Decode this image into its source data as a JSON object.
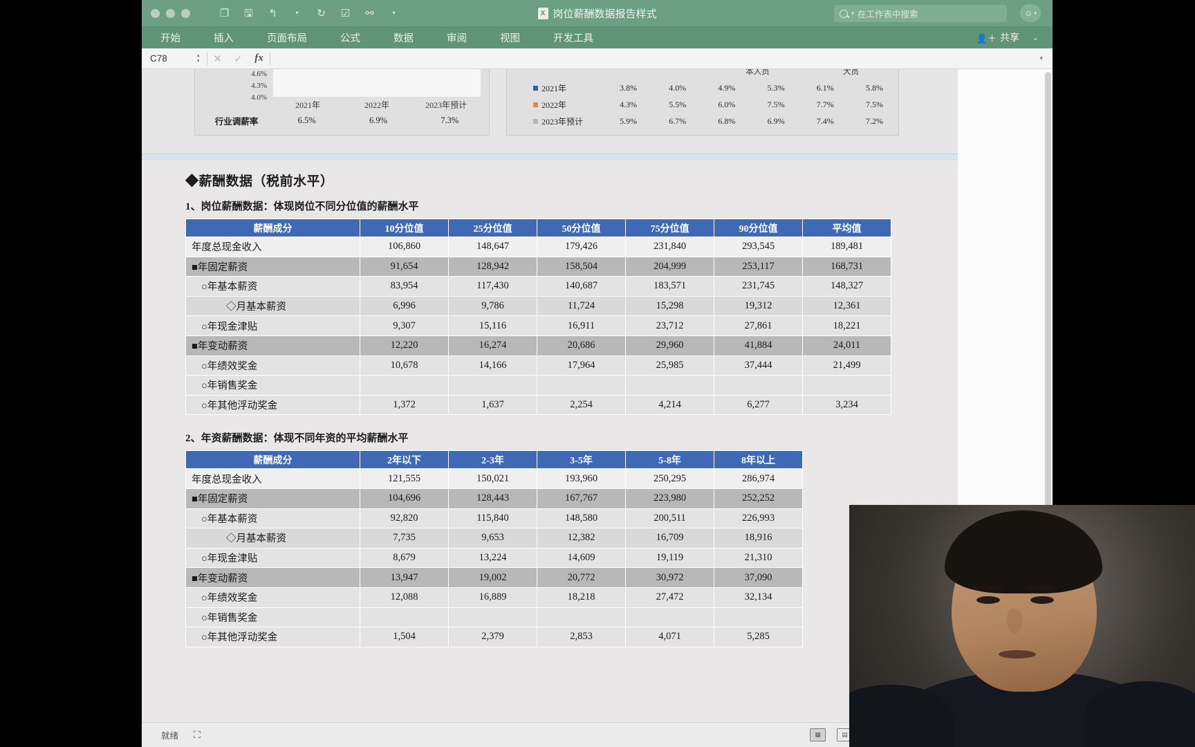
{
  "window": {
    "title": "岗位薪酬数据报告样式",
    "traffic_lights": [
      "close",
      "minimize",
      "zoom"
    ],
    "quick_access_icons": [
      "sidebar-icon",
      "save-icon",
      "undo-icon",
      "undo-caret-icon",
      "redo-icon",
      "edit-icon",
      "link-icon",
      "overflow-caret-icon"
    ],
    "search_placeholder": "在工作表中搜索",
    "share_label": "共享",
    "account_icon": "account-smiley-icon"
  },
  "ribbon": {
    "tabs": [
      "开始",
      "插入",
      "页面布局",
      "公式",
      "数据",
      "审阅",
      "视图",
      "开发工具"
    ],
    "active_tab": "开始"
  },
  "formula_bar": {
    "name_box": "C78",
    "cancel_icon": "cancel-icon",
    "confirm_icon": "confirm-icon",
    "fx_label": "fx",
    "value": ""
  },
  "charts": {
    "adjust_rate_chart": {
      "y_ticks": [
        "4.6%",
        "4.3%",
        "4.0%"
      ],
      "x_labels": [
        "2021年",
        "2022年",
        "2023年预计"
      ],
      "row_label": "行业调薪率",
      "row_values": [
        "6.5%",
        "6.9%",
        "7.3%"
      ]
    },
    "legend_chart": {
      "column_headers": [
        "本人员",
        "大员"
      ],
      "rows": [
        {
          "marker_color": "#2f5fa8",
          "label": "2021年",
          "values": [
            "3.8%",
            "4.0%",
            "4.9%",
            "5.3%",
            "6.1%",
            "5.8%"
          ]
        },
        {
          "marker_color": "#e08a3c",
          "label": "2022年",
          "values": [
            "4.3%",
            "5.5%",
            "6.0%",
            "7.5%",
            "7.7%",
            "7.5%"
          ]
        },
        {
          "marker_color": "#b4b4b4",
          "label": "2023年预计",
          "values": [
            "5.9%",
            "6.7%",
            "6.8%",
            "6.9%",
            "7.4%",
            "7.2%"
          ]
        }
      ]
    }
  },
  "content": {
    "section_title": "◆薪酬数据（税前水平）",
    "table1": {
      "caption": "1、岗位薪酬数据：体现岗位不同分位值的薪酬水平",
      "headers": [
        "薪酬成分",
        "10分位值",
        "25分位值",
        "50分位值",
        "75分位值",
        "90分位值",
        "平均值"
      ],
      "rows": [
        {
          "level": 0,
          "label": "年度总现金收入",
          "values": [
            "106,860",
            "148,647",
            "179,426",
            "231,840",
            "293,545",
            "189,481"
          ]
        },
        {
          "level": 1,
          "label": "■年固定薪资",
          "values": [
            "91,654",
            "128,942",
            "158,504",
            "204,999",
            "253,117",
            "168,731"
          ]
        },
        {
          "level": 2,
          "label": "○年基本薪资",
          "values": [
            "83,954",
            "117,430",
            "140,687",
            "183,571",
            "231,745",
            "148,327"
          ]
        },
        {
          "level": 3,
          "label": "◇月基本薪资",
          "values": [
            "6,996",
            "9,786",
            "11,724",
            "15,298",
            "19,312",
            "12,361"
          ]
        },
        {
          "level": 2,
          "label": "○年现金津贴",
          "values": [
            "9,307",
            "15,116",
            "16,911",
            "23,712",
            "27,861",
            "18,221"
          ]
        },
        {
          "level": 1,
          "label": "■年变动薪资",
          "values": [
            "12,220",
            "16,274",
            "20,686",
            "29,960",
            "41,884",
            "24,011"
          ]
        },
        {
          "level": 2,
          "label": "○年绩效奖金",
          "values": [
            "10,678",
            "14,166",
            "17,964",
            "25,985",
            "37,444",
            "21,499"
          ]
        },
        {
          "level": 2,
          "label": "○年销售奖金",
          "values": [
            "",
            "",
            "",
            "",
            "",
            ""
          ]
        },
        {
          "level": 2,
          "label": "○年其他浮动奖金",
          "values": [
            "1,372",
            "1,637",
            "2,254",
            "4,214",
            "6,277",
            "3,234"
          ]
        }
      ]
    },
    "table2": {
      "caption": "2、年资薪酬数据：体现不同年资的平均薪酬水平",
      "headers": [
        "薪酬成分",
        "2年以下",
        "2-3年",
        "3-5年",
        "5-8年",
        "8年以上"
      ],
      "rows": [
        {
          "level": 0,
          "label": "年度总现金收入",
          "values": [
            "121,555",
            "150,021",
            "193,960",
            "250,295",
            "286,974"
          ]
        },
        {
          "level": 1,
          "label": "■年固定薪资",
          "values": [
            "104,696",
            "128,443",
            "167,767",
            "223,980",
            "252,252"
          ]
        },
        {
          "level": 2,
          "label": "○年基本薪资",
          "values": [
            "92,820",
            "115,840",
            "148,580",
            "200,511",
            "226,993"
          ]
        },
        {
          "level": 3,
          "label": "◇月基本薪资",
          "values": [
            "7,735",
            "9,653",
            "12,382",
            "16,709",
            "18,916"
          ]
        },
        {
          "level": 2,
          "label": "○年现金津贴",
          "values": [
            "8,679",
            "13,224",
            "14,609",
            "19,119",
            "21,310"
          ]
        },
        {
          "level": 1,
          "label": "■年变动薪资",
          "values": [
            "13,947",
            "19,002",
            "20,772",
            "30,972",
            "37,090"
          ]
        },
        {
          "level": 2,
          "label": "○年绩效奖金",
          "values": [
            "12,088",
            "16,889",
            "18,218",
            "27,472",
            "32,134"
          ]
        },
        {
          "level": 2,
          "label": "○年销售奖金",
          "values": [
            "",
            "",
            "",
            "",
            ""
          ]
        },
        {
          "level": 2,
          "label": "○年其他浮动奖金",
          "values": [
            "1,504",
            "2,379",
            "2,853",
            "4,071",
            "5,285"
          ]
        }
      ]
    }
  },
  "status_bar": {
    "status_text": "就绪",
    "accessibility_icon": "accessibility-icon",
    "view_buttons": [
      "normal-view-icon",
      "page-layout-icon",
      "page-break-icon"
    ],
    "zoom_minus": "−",
    "zoom_plus": "+"
  },
  "colors": {
    "titlebar": "#6d9f82",
    "ribbon": "#5f9476",
    "table_header": "#3f68b5",
    "row_level1": "#b8b8b8",
    "accent_blue": "#2f5fa8"
  }
}
